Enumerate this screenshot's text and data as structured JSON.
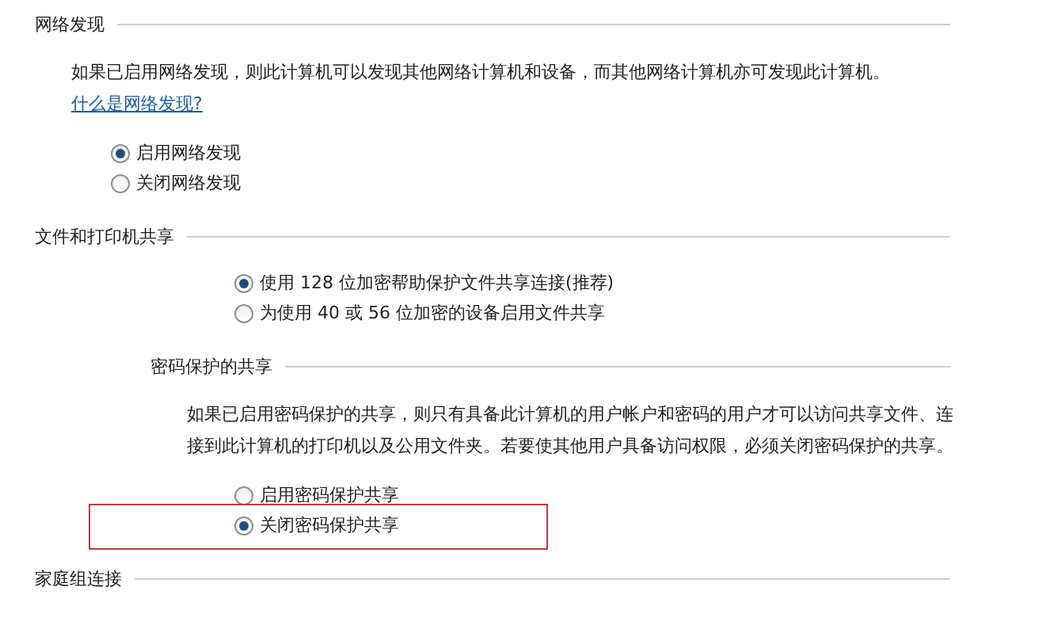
{
  "sections": [
    {
      "title": "网络发现",
      "description": "如果已启用网络发现，则此计算机可以发现其他网络计算机和设备，而其他网络计算机亦可发现此计算机。",
      "link": "什么是网络发现?",
      "options": [
        {
          "label": "启用网络发现",
          "selected": true,
          "highlighted": false
        },
        {
          "label": "关闭网络发现",
          "selected": false,
          "highlighted": false
        }
      ]
    },
    {
      "title": "文件和打印机共享",
      "children": [
        {
          "options": [
            {
              "label": "使用 128 位加密帮助保护文件共享连接(推荐)",
              "selected": true,
              "highlighted": false
            },
            {
              "label": "为使用 40 或 56 位加密的设备启用文件共享",
              "selected": false,
              "highlighted": false
            }
          ]
        },
        {
          "title": "密码保护的共享",
          "description": "如果已启用密码保护的共享，则只有具备此计算机的用户帐户和密码的用户才可以访问共享文件、连接到此计算机的打印机以及公用文件夹。若要使其他用户具备访问权限，必须关闭密码保护的共享。",
          "options": [
            {
              "label": "启用密码保护共享",
              "selected": false,
              "highlighted": false
            },
            {
              "label": "关闭密码保护共享",
              "selected": true,
              "highlighted": true
            }
          ]
        }
      ]
    },
    {
      "title": "家庭组连接"
    }
  ]
}
